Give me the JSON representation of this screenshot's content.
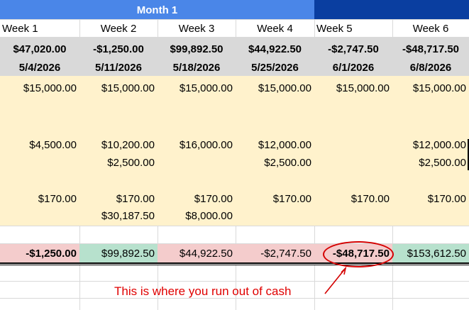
{
  "header": {
    "month_label": "Month 1",
    "weeks": [
      "Week 1",
      "Week 2",
      "Week 3",
      "Week 4",
      "Week 5",
      "Week 6"
    ],
    "start_balances": [
      "$47,020.00",
      "-$1,250.00",
      "$99,892.50",
      "$44,922.50",
      "-$2,747.50",
      "-$48,717.50"
    ],
    "dates": [
      "5/4/2026",
      "5/11/2026",
      "5/18/2026",
      "5/25/2026",
      "6/1/2026",
      "6/8/2026"
    ]
  },
  "body": {
    "row1": [
      "$15,000.00",
      "$15,000.00",
      "$15,000.00",
      "$15,000.00",
      "$15,000.00",
      "$15,000.00"
    ],
    "row2": [
      "$4,500.00",
      "$10,200.00",
      "$16,000.00",
      "$12,000.00",
      "",
      "$12,000.00"
    ],
    "row3": [
      "",
      "$2,500.00",
      "",
      "$2,500.00",
      "",
      "$2,500.00"
    ],
    "row4": [
      "$170.00",
      "$170.00",
      "$170.00",
      "$170.00",
      "$170.00",
      "$170.00"
    ],
    "row5": [
      "",
      "$30,187.50",
      "$8,000.00",
      "",
      "",
      ""
    ]
  },
  "ending_balances": [
    "-$1,250.00",
    "$99,892.50",
    "$44,922.50",
    "-$2,747.50",
    "-$48,717.50",
    "$153,612.50"
  ],
  "annotation": {
    "text": "This is where you run out of cash"
  },
  "colors": {
    "month_header_bg": "#4a86e8",
    "dark_header_bg": "#0a3ea0",
    "summary_bg": "#d9d9d9",
    "body_bg": "#fff2cc",
    "negative_bg": "#f4cccc",
    "positive_bg": "#b7e1cd",
    "annotation": "#e00000"
  }
}
